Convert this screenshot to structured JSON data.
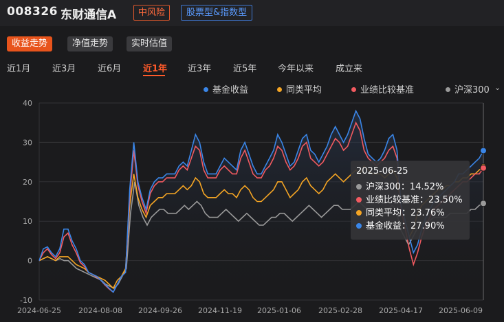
{
  "header": {
    "fund_code": "008326",
    "fund_name": "东财通信A",
    "risk_tag": "中风险",
    "type_tag": "股票型&指数型"
  },
  "view_tabs": [
    {
      "label": "收益走势",
      "active": true
    },
    {
      "label": "净值走势",
      "active": false
    },
    {
      "label": "实时估值",
      "active": false
    }
  ],
  "periods": [
    {
      "label": "近1月",
      "active": false
    },
    {
      "label": "近3月",
      "active": false
    },
    {
      "label": "近6月",
      "active": false
    },
    {
      "label": "近1年",
      "active": true
    },
    {
      "label": "近3年",
      "active": false
    },
    {
      "label": "近5年",
      "active": false
    },
    {
      "label": "今年以来",
      "active": false
    },
    {
      "label": "成立来",
      "active": false
    }
  ],
  "legend": [
    {
      "label": "基金收益",
      "color": "#3a86e8"
    },
    {
      "label": "同类平均",
      "color": "#f5a524"
    },
    {
      "label": "业绩比较基准",
      "color": "#f25a60"
    },
    {
      "label": "沪深300",
      "color": "#9a9a9a"
    }
  ],
  "tooltip": {
    "date": "2025-06-25",
    "rows": [
      {
        "label": "沪深300：14.52%",
        "color": "#9a9a9a"
      },
      {
        "label": "业绩比较基准：23.50%",
        "color": "#f25a60"
      },
      {
        "label": "同类平均：23.76%",
        "color": "#f5a524"
      },
      {
        "label": "基金收益：27.90%",
        "color": "#3a86e8"
      }
    ]
  },
  "chart_data": {
    "type": "line",
    "ylim": [
      -10,
      40
    ],
    "y_ticks": [
      "40",
      "30",
      "20",
      "10",
      "0",
      "-10"
    ],
    "x_ticks": [
      "2024-06-25",
      "2024-08-08",
      "2024-09-26",
      "2024-11-19",
      "2025-01-06",
      "2025-02-28",
      "2025-04-17",
      "2025-06-09"
    ],
    "series": [
      {
        "name": "基金收益",
        "color": "#3a86e8",
        "values": [
          0,
          3,
          3.5,
          2,
          1,
          3,
          8,
          8,
          5,
          3,
          0,
          -1,
          -3,
          -3.5,
          -4,
          -5,
          -6,
          -7,
          -8,
          -6,
          -4,
          -3,
          18,
          30,
          20,
          16,
          13,
          18,
          20,
          21,
          21,
          22,
          22,
          22,
          24,
          25,
          24,
          28,
          32,
          30,
          25,
          22,
          22,
          22,
          24,
          26,
          25,
          24,
          23,
          28,
          30,
          27,
          24,
          22,
          22,
          24,
          26,
          28,
          32,
          30,
          27,
          24,
          25,
          28,
          31,
          32,
          28,
          27,
          25,
          27,
          29,
          32,
          34,
          32,
          30,
          32,
          35,
          38,
          36,
          31,
          27,
          26,
          25,
          26,
          28,
          31,
          32,
          28,
          14,
          10,
          6,
          2,
          4,
          8,
          11,
          13,
          15,
          16,
          17,
          18,
          19,
          20,
          22,
          22,
          23,
          24,
          25,
          26,
          27.9
        ]
      },
      {
        "name": "同类平均",
        "color": "#f5a524",
        "values": [
          0,
          0.5,
          1,
          0.5,
          0,
          1,
          1,
          1,
          0,
          -1,
          -1.5,
          -2,
          -3,
          -3.5,
          -4,
          -4.5,
          -5,
          -6,
          -7,
          -5,
          -4,
          -2,
          14,
          22,
          16,
          13,
          11,
          14,
          15,
          16,
          16,
          17,
          17,
          17,
          18,
          19,
          18,
          19,
          21,
          20,
          17,
          16,
          16,
          16,
          17,
          18,
          17,
          17,
          16,
          18,
          19,
          18,
          16,
          15,
          15,
          16,
          17,
          18,
          20,
          20,
          18,
          16,
          17,
          18,
          20,
          21,
          19,
          18,
          17,
          18,
          20,
          21,
          22,
          21,
          20,
          21,
          22,
          23,
          22,
          24,
          23,
          22,
          22,
          22,
          21,
          22,
          23,
          21,
          14,
          10,
          6,
          8,
          12,
          14,
          15,
          16,
          17,
          18,
          18,
          19,
          19,
          20,
          20,
          21,
          21,
          22,
          22,
          23,
          23.76
        ]
      },
      {
        "name": "业绩比较基准",
        "color": "#f25a60",
        "values": [
          0,
          2,
          3,
          1.5,
          0.5,
          2,
          6,
          7,
          4,
          2,
          -0.5,
          -1.5,
          -3,
          -3.5,
          -4.2,
          -5,
          -6.2,
          -7.2,
          -8,
          -6,
          -4,
          -3,
          16,
          28,
          19,
          15,
          12,
          17,
          19,
          20,
          20,
          21,
          21,
          21,
          23,
          24,
          23,
          26,
          29,
          28,
          23,
          21,
          21,
          21,
          23,
          24,
          23,
          22,
          22,
          26,
          28,
          25,
          22,
          21,
          21,
          23,
          24,
          26,
          29,
          28,
          25,
          23,
          24,
          26,
          29,
          30,
          26,
          25,
          24,
          25,
          27,
          29,
          31,
          30,
          28,
          29,
          32,
          35,
          33,
          28,
          26,
          25,
          24,
          25,
          26,
          28,
          29,
          26,
          13,
          8,
          3,
          -1,
          2,
          6,
          9,
          11,
          13,
          14,
          15,
          16,
          17,
          18,
          19,
          20,
          20,
          21,
          22,
          22,
          23.5
        ]
      },
      {
        "name": "沪深300",
        "color": "#9a9a9a",
        "values": [
          0,
          0.5,
          1,
          0.5,
          0,
          0.5,
          0,
          0,
          -1,
          -2,
          -2.5,
          -3,
          -3.5,
          -4,
          -4.5,
          -5,
          -6,
          -6.5,
          -7,
          -6,
          -4,
          -2,
          12,
          20,
          14,
          11,
          9,
          11,
          12,
          13,
          13,
          12,
          12,
          12,
          13,
          14,
          13,
          14,
          15,
          14,
          12,
          11,
          11,
          11,
          12,
          13,
          12,
          11,
          10,
          11,
          12,
          11,
          10,
          9,
          9,
          10,
          11,
          11,
          12,
          12,
          11,
          10,
          11,
          12,
          13,
          14,
          13,
          12,
          11,
          12,
          13,
          14,
          14,
          13,
          13,
          13,
          14,
          15,
          14,
          13,
          12,
          12,
          12,
          12,
          13,
          14,
          13,
          8,
          6,
          4,
          6,
          8,
          9,
          10,
          10,
          11,
          11,
          11,
          11,
          12,
          12,
          12,
          12,
          12,
          13,
          13,
          14,
          14.52
        ]
      }
    ]
  }
}
